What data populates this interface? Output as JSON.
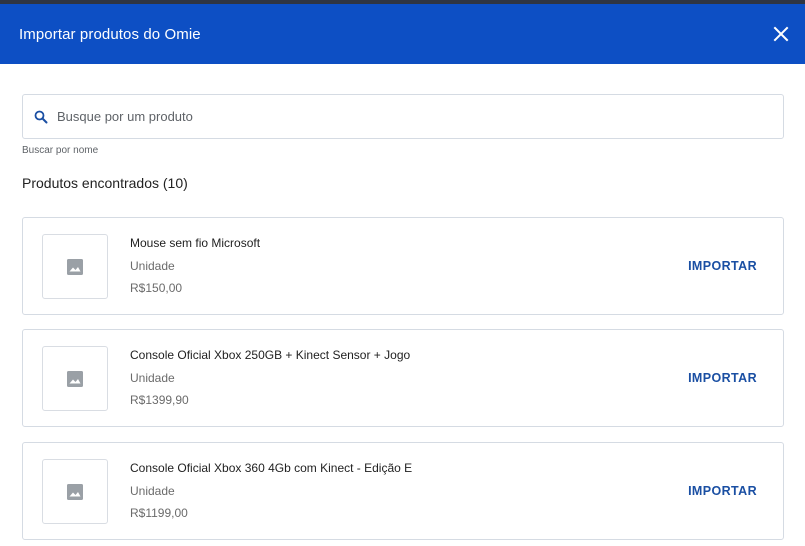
{
  "modal": {
    "title": "Importar produtos do Omie",
    "close_icon": "close-icon",
    "header_color": "#0d4fc4"
  },
  "search": {
    "placeholder": "Busque por um produto",
    "value": "",
    "helper": "Buscar por nome",
    "icon": "search-icon"
  },
  "results": {
    "title": "Produtos encontrados (10)",
    "import_label": "IMPORTAR",
    "thumbnail_icon": "image-icon",
    "items": [
      {
        "name": "Mouse sem fio Microsoft",
        "unit": "Unidade",
        "price": "R$150,00"
      },
      {
        "name": "Console Oficial Xbox 250GB + Kinect Sensor + Jogo",
        "unit": "Unidade",
        "price": "R$1399,90"
      },
      {
        "name": "Console Oficial Xbox 360 4Gb com Kinect - Edição E",
        "unit": "Unidade",
        "price": "R$1199,00"
      }
    ]
  }
}
